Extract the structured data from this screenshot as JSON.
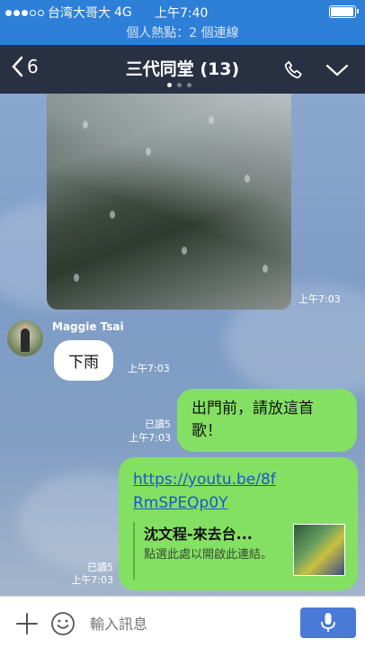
{
  "status_bar": {
    "carrier": "台湾大哥大",
    "network": "4G",
    "time": "上午7:40",
    "signal_bars": 2,
    "signal_total": 5,
    "battery_level": 0.95
  },
  "hotspot": {
    "text": "個人熱點：2 個連線"
  },
  "header": {
    "back_count": "6",
    "title": "三代同堂 (13)",
    "page_index": 1,
    "page_total": 3
  },
  "messages": {
    "photo": {
      "time": "上午7:03"
    },
    "incoming": {
      "sender": "Maggie Tsai",
      "text": "下雨",
      "time": "上午7:03"
    },
    "outgoing1": {
      "text": "出門前，請放這首歌！",
      "read": "已讀5",
      "time": "上午7:03"
    },
    "outgoing2": {
      "link": "https://youtu.be/8fRmSPEQp0Y",
      "preview_title": "沈文程-來去台...",
      "preview_desc": "點選此處以開啟此連結。",
      "read": "已讀5",
      "time": "上午7:03"
    }
  },
  "input_bar": {
    "placeholder": "輸入訊息"
  },
  "colors": {
    "status_bar": "#2d7fd8",
    "header": "#283041",
    "bubble_out": "#84e063",
    "mic_button": "#4a7ad8"
  }
}
